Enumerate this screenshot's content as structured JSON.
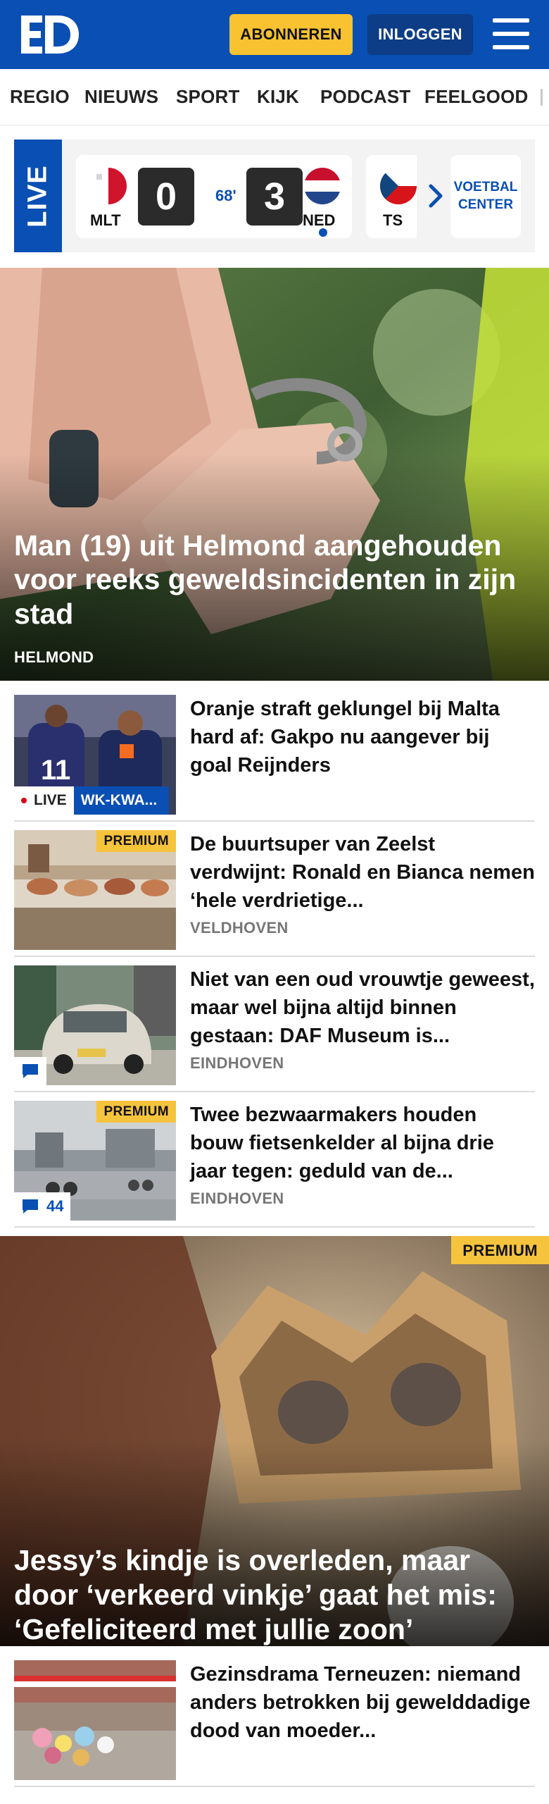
{
  "header": {
    "logo_text": "ED",
    "subscribe_label": "ABONNEREN",
    "login_label": "INLOGGEN",
    "menu_icon": "hamburger-icon"
  },
  "nav": {
    "items": [
      "REGIO",
      "NIEUWS",
      "SPORT",
      "KIJK",
      "PODCAST",
      "FEELGOOD"
    ]
  },
  "live_widget": {
    "tab_label": "LIVE",
    "match": {
      "home_team": "MLT",
      "home_score": "0",
      "minute": "68'",
      "away_score": "3",
      "away_team": "NED"
    },
    "next_match_team": "TS",
    "center_label_1": "VOETBAL",
    "center_label_2": "CENTER"
  },
  "hero": {
    "title": "Man (19) uit Helmond aangehouden voor reeks geweldsincidenten in zijn stad",
    "kicker": "HELMOND"
  },
  "articles": [
    {
      "title": "Oranje straft geklungel bij Malta hard af: Gakpo nu aangever bij goal Reijnders",
      "live_label": "LIVE",
      "tag": "WK-KWA..."
    },
    {
      "title": "De buurtsuper van Zeelst verdwijnt: Ronald en Bianca nemen ‘hele verdrietige...",
      "kicker": "VELDHOVEN",
      "premium": "PREMIUM"
    },
    {
      "title": "Niet van een oud vrouwtje geweest, maar wel bijna altijd binnen gestaan: DAF Museum is...",
      "kicker": "EINDHOVEN"
    },
    {
      "title": "Twee bezwaarmakers houden bouw fietsenkelder al bijna drie jaar tegen: geduld van de...",
      "kicker": "EINDHOVEN",
      "premium": "PREMIUM",
      "comments": "44"
    }
  ],
  "feature": {
    "title": "Jessy’s kindje is overleden, maar door ‘verkeerd vinkje’ gaat het mis: ‘Gefeliciteerd met jullie zoon’",
    "premium": "PREMIUM"
  },
  "article_bottom": {
    "title": "Gezinsdrama Terneuzen: niemand anders betrokken bij gewelddadige dood van moeder..."
  },
  "colors": {
    "brand_blue": "#0a4fb3",
    "accent_yellow": "#f8c230",
    "premium_yellow": "#f6c33d"
  }
}
